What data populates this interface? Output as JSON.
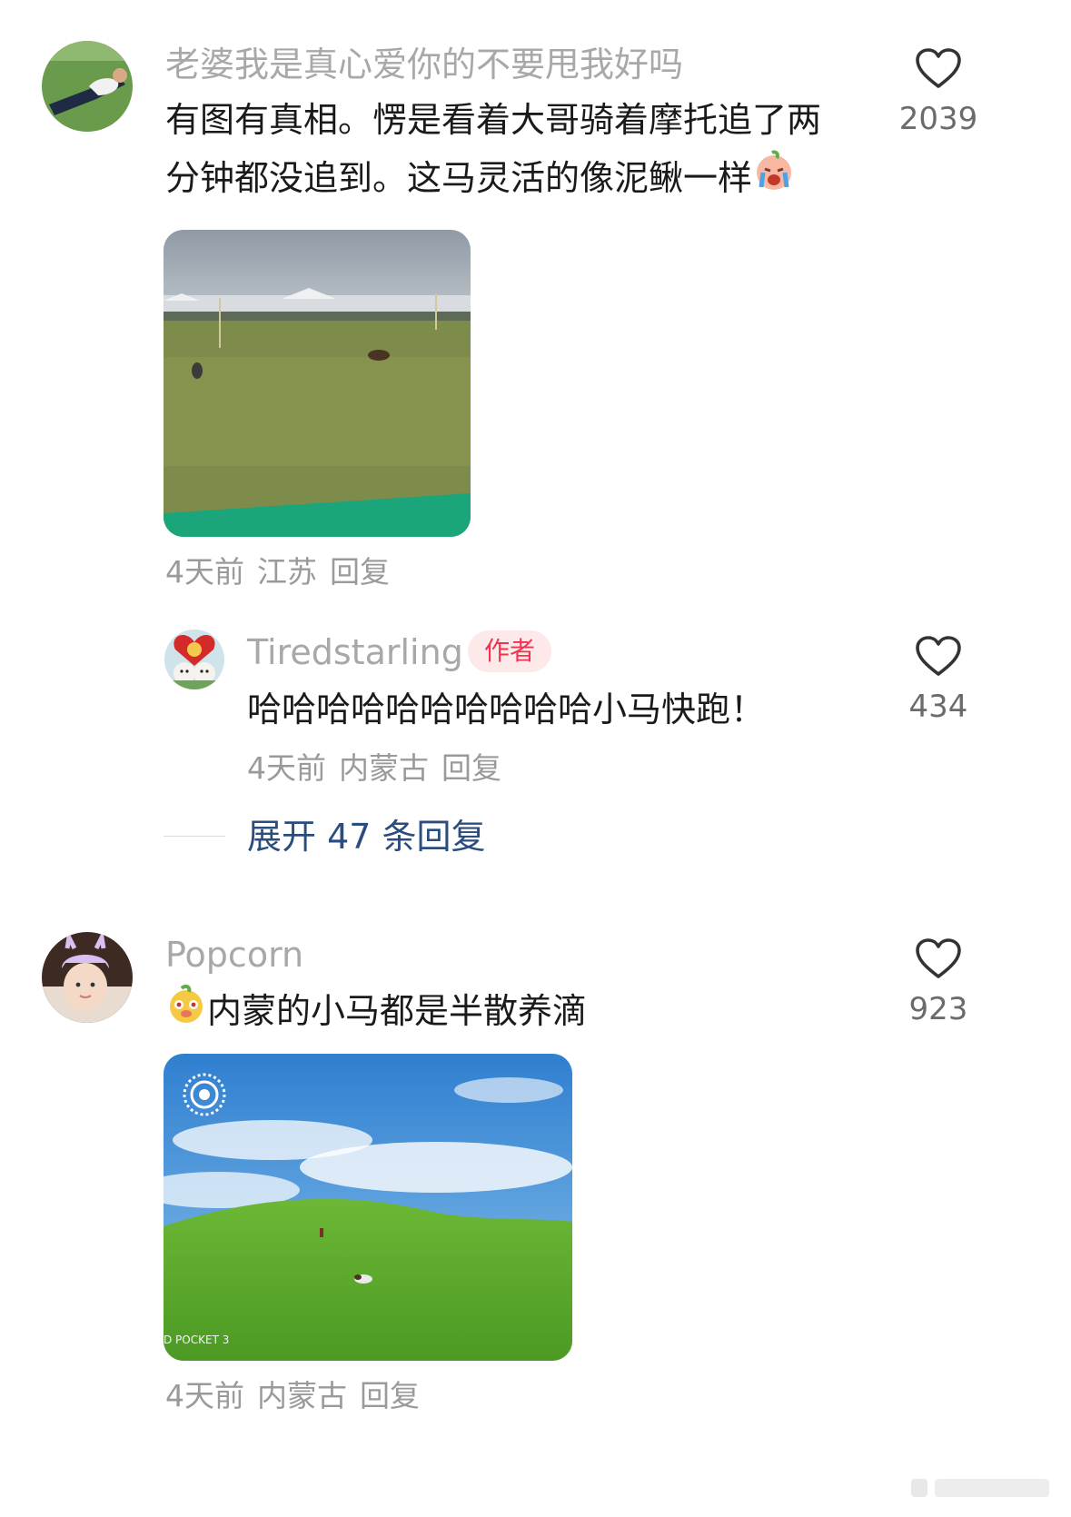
{
  "comments": [
    {
      "username": "老婆我是真心爱你的不要甩我好吗",
      "text_line1": "有图有真相。愣是看着大哥骑着摩托追了两",
      "text_line2": "分钟都没追到。这马灵活的像泥鳅一样",
      "emoji": "crying-face-emoji",
      "likes": "2039",
      "meta": {
        "time": "4天前",
        "location": "江苏",
        "reply": "回复"
      },
      "replies": [
        {
          "username": "Tiredstarling",
          "badge": "作者",
          "text": "哈哈哈哈哈哈哈哈哈哈小马快跑！",
          "likes": "434",
          "meta": {
            "time": "4天前",
            "location": "内蒙古",
            "reply": "回复"
          }
        }
      ],
      "expand_label": "展开 47 条回复"
    },
    {
      "username": "Popcorn",
      "text": "内蒙的小马都是半散养滴",
      "emoji": "dog-face-emoji",
      "likes": "923",
      "photo_caption": "D POCKET 3",
      "meta": {
        "time": "4天前",
        "location": "内蒙古",
        "reply": "回复"
      }
    }
  ],
  "colors": {
    "username": "#a8a8a8",
    "text": "#1a1a1a",
    "meta": "#9a9a9a",
    "link": "#2b4d7e",
    "author_badge_bg": "#fde8ea",
    "author_badge_fg": "#f0334f"
  }
}
